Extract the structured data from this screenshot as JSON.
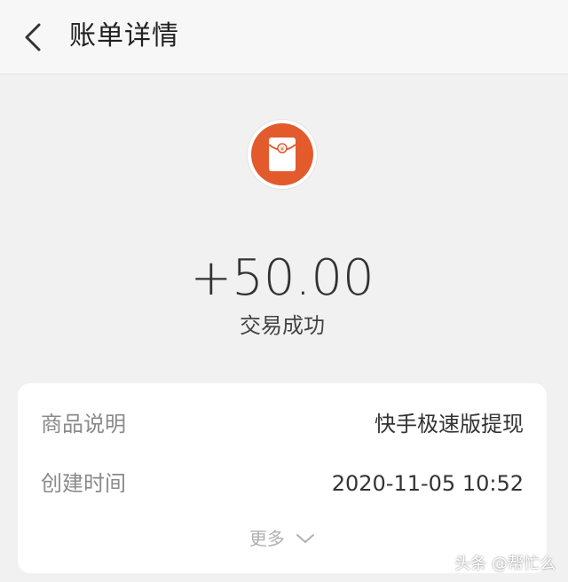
{
  "header": {
    "title": "账单详情",
    "back_icon": "back-arrow-icon"
  },
  "transaction": {
    "icon": "red-envelope-icon",
    "icon_color": "#e35a2c",
    "amount": "+50.00",
    "status": "交易成功"
  },
  "details": {
    "rows": [
      {
        "label": "商品说明",
        "value": "快手极速版提现"
      },
      {
        "label": "创建时间",
        "value": "2020-11-05 10:52"
      }
    ],
    "more_label": "更多"
  },
  "watermark": "头条 @帮忙么"
}
